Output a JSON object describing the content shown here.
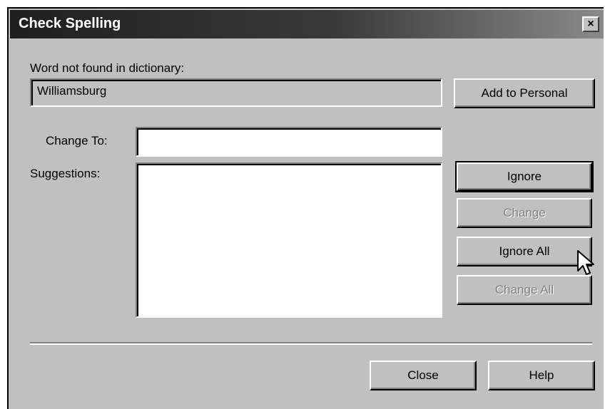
{
  "window": {
    "title": "Check Spelling",
    "close_glyph": "×"
  },
  "word_not_found": {
    "label": "Word not found in dictionary:",
    "value": "Williamsburg"
  },
  "change_to": {
    "label": "Change To:",
    "value": ""
  },
  "suggestions": {
    "label": "Suggestions:",
    "items": []
  },
  "buttons": {
    "add_to_personal": "Add to Personal",
    "ignore": "Ignore",
    "change": "Change",
    "ignore_all": "Ignore All",
    "change_all": "Change All",
    "close": "Close",
    "help": "Help"
  },
  "states": {
    "change_enabled": false,
    "change_all_enabled": false,
    "default_button": "ignore"
  },
  "icons": {
    "cursor": "arrow-cursor-icon"
  }
}
